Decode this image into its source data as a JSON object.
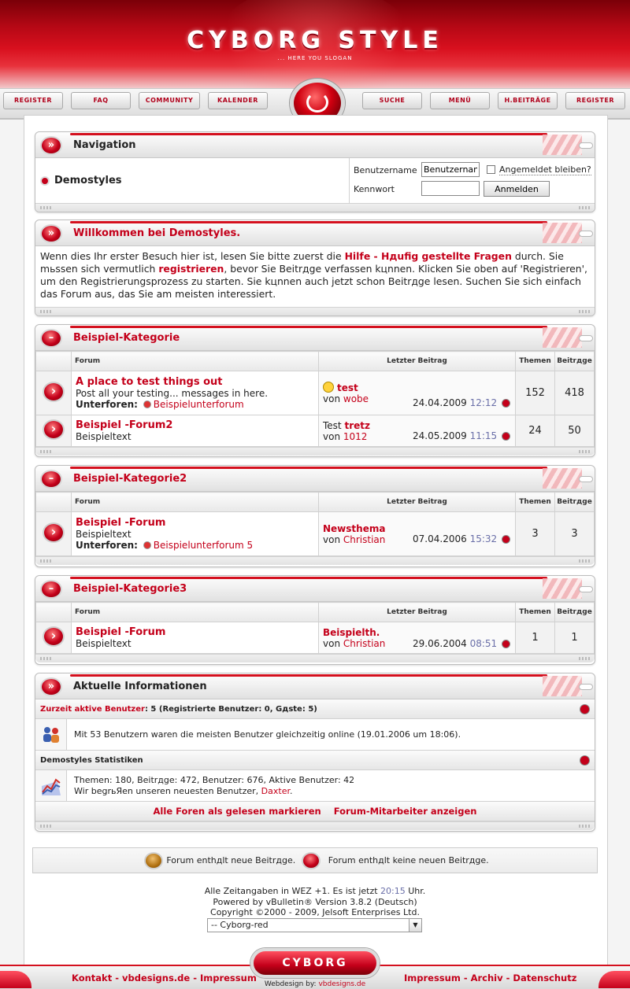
{
  "header": {
    "logo": "CYBORG STYLE",
    "slogan": "... HERE YOU SLOGAN"
  },
  "nav": {
    "register": "REGISTER",
    "faq": "FAQ",
    "community": "COMMUNITY",
    "calendar": "KALENDER",
    "search": "SUCHE",
    "menu": "MENÜ",
    "new_posts": "H.BEITRÄGE",
    "register2": "REGISTER"
  },
  "navigation": {
    "title": "Navigation",
    "site": "Demostyles",
    "username_label": "Benutzername",
    "username_value": "Benutzernan",
    "remember": "Angemeldet bleiben?",
    "password_label": "Kennwort",
    "login_button": "Anmelden"
  },
  "welcome": {
    "title": "Willkommen bei Demostyles.",
    "t1": "Wenn dies Ihr erster Besuch hier ist, lesen Sie bitte zuerst die ",
    "link1": "Hilfe - Hдufig gestellte Fragen",
    "t2": " durch. Sie mьssen sich vermutlich ",
    "link2": "registrieren",
    "t3": ", bevor Sie Beitrдge verfassen kцnnen. Klicken Sie oben auf 'Registrieren', um den Registrierungsprozess zu starten. Sie kцnnen auch jetzt schon Beitrдge lesen. Suchen Sie sich einfach das Forum aus, das Sie am meisten interessiert."
  },
  "columns": {
    "forum": "Forum",
    "last": "Letzter Beitrag",
    "threads": "Themen",
    "posts": "Beitrдge"
  },
  "cat1": {
    "title": "Beispiel-Kategorie",
    "f1": {
      "title": "A place to test things out",
      "desc": "Post all your testing... messages in here.",
      "sub_label": "Unterforen:",
      "sub": "Beispielunterforum",
      "last_title": "test",
      "by": "von",
      "user": "wobe",
      "date": "24.04.2009",
      "time": "12:12",
      "threads": "152",
      "posts": "418"
    },
    "f2": {
      "title": "Beispiel -Forum2",
      "desc": "Beispieltext",
      "last_prefix": "Test",
      "last_title": "tretz",
      "by": "von",
      "user": "1012",
      "date": "24.05.2009",
      "time": "11:15",
      "threads": "24",
      "posts": "50"
    }
  },
  "cat2": {
    "title": "Beispiel-Kategorie2",
    "f1": {
      "title": "Beispiel -Forum",
      "desc": "Beispieltext",
      "sub_label": "Unterforen:",
      "sub": "Beispielunterforum 5",
      "last_title": "Newsthema",
      "by": "von",
      "user": "Christian",
      "date": "07.04.2006",
      "time": "15:32",
      "threads": "3",
      "posts": "3"
    }
  },
  "cat3": {
    "title": "Beispiel-Kategorie3",
    "f1": {
      "title": "Beispiel -Forum",
      "desc": "Beispieltext",
      "last_title": "Beispielth.",
      "by": "von",
      "user": "Christian",
      "date": "29.06.2004",
      "time": "08:51",
      "threads": "1",
      "posts": "1"
    }
  },
  "info": {
    "title": "Aktuelle Informationen",
    "active_link": "Zurzeit aktive Benutzer",
    "active_rest": ": 5 (Registrierte Benutzer: 0, Gдste: 5)",
    "record": "Mit 53 Benutzern waren die meisten Benutzer gleichzeitig online (19.01.2006 um 18:06).",
    "stats_title": "Demostyles Statistiken",
    "stats_line": "Themen: 180, Beitrдge: 472, Benutzer: 676, Aktive Benutzer: 42",
    "welcome_pre": "Wir begrьЯen unseren neuesten Benutzer, ",
    "newest": "Daxter",
    "welcome_post": ".",
    "mark_read": "Alle Foren als gelesen markieren",
    "staff": "Forum-Mitarbeiter anzeigen"
  },
  "legend": {
    "new": "Forum enthдlt neue Beitrдge.",
    "nonew": "Forum enthдlt keine neuen Beitrдge."
  },
  "footer": {
    "tz_pre": "Alle Zeitangaben in WEZ +1. Es ist jetzt ",
    "time": "20:15",
    "tz_post": " Uhr.",
    "powered": "Powered by vBulletin® Version 3.8.2 (Deutsch)",
    "copyright": "Copyright ©2000 - 2009, Jelsoft Enterprises Ltd.",
    "style": "-- Cyborg-red",
    "left_links": "Kontakt - vbdesigns.de - Impressum",
    "logo": "CYBORG",
    "webdesign": "Webdesign by:",
    "webdesign_link": "vbdesigns.de",
    "right_links": "Impressum - Archiv - Datenschutz"
  },
  "colors": {
    "accent": "#c4001a",
    "header": "#b50815",
    "link_time": "#6a6fa8"
  }
}
